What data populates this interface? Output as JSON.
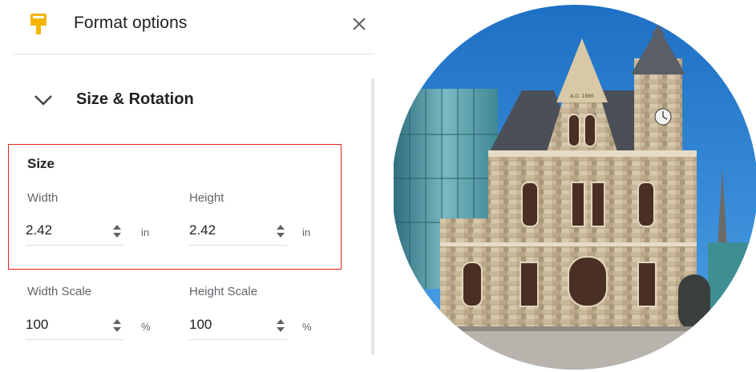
{
  "panel": {
    "title": "Format options",
    "icon": "paintbrush-icon",
    "accent_color": "#f4b400"
  },
  "section": {
    "title": "Size & Rotation",
    "expanded": true
  },
  "size": {
    "group_label": "Size",
    "width": {
      "label": "Width",
      "value": "2.42",
      "unit": "in"
    },
    "height": {
      "label": "Height",
      "value": "2.42",
      "unit": "in"
    }
  },
  "scale": {
    "width": {
      "label": "Width Scale",
      "value": "100",
      "unit": "%"
    },
    "height": {
      "label": "Height Scale",
      "value": "100",
      "unit": "%"
    }
  },
  "image": {
    "subject": "Victorian stone building with tower, circular crop",
    "engraving": "A.D. 1886"
  },
  "colors": {
    "highlight": "#e0211c",
    "sky": "#1e73c8"
  }
}
